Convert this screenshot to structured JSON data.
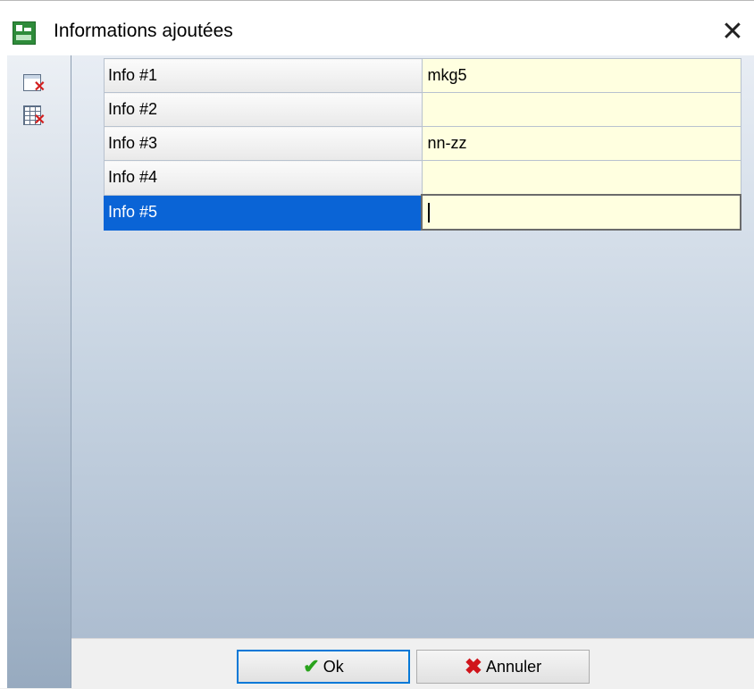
{
  "window": {
    "title": "Informations ajoutées",
    "close_glyph": "✕"
  },
  "toolbar": {
    "tools": [
      {
        "icon": "clear-field-icon"
      },
      {
        "icon": "clear-table-icon"
      }
    ]
  },
  "rows": [
    {
      "label": "Info #1",
      "value": "mkg5"
    },
    {
      "label": "Info #2",
      "value": ""
    },
    {
      "label": "Info #3",
      "value": "nn-zz"
    },
    {
      "label": "Info #4",
      "value": ""
    },
    {
      "label": "Info #5",
      "value": ""
    }
  ],
  "buttons": {
    "ok_label": "Ok",
    "cancel_label": "Annuler"
  },
  "colors": {
    "selected_row": "#0a64d6",
    "value_bg": "#ffffe0",
    "focus_border": "#0078d7"
  }
}
